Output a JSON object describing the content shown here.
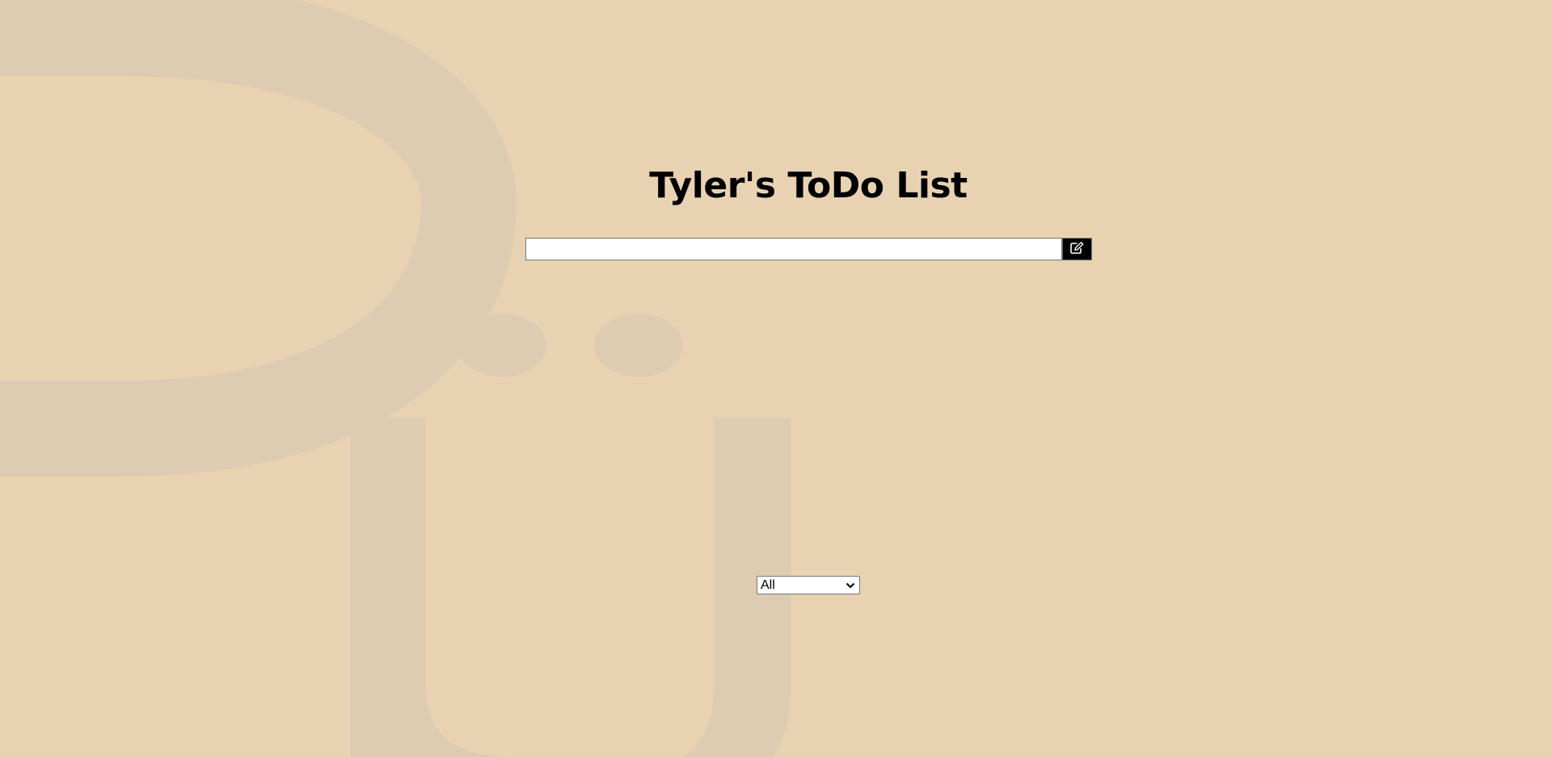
{
  "app": {
    "title": "Tyler's ToDo List"
  },
  "form": {
    "input_value": "",
    "input_placeholder": "",
    "submit_icon": "edit-icon"
  },
  "todos": [],
  "filter": {
    "selected": "All",
    "options": [
      "All"
    ]
  },
  "colors": {
    "background": "#e8d2b2",
    "watermark": "#ddcbb2",
    "button": "#000000"
  },
  "watermark": {
    "text": "Dü"
  }
}
